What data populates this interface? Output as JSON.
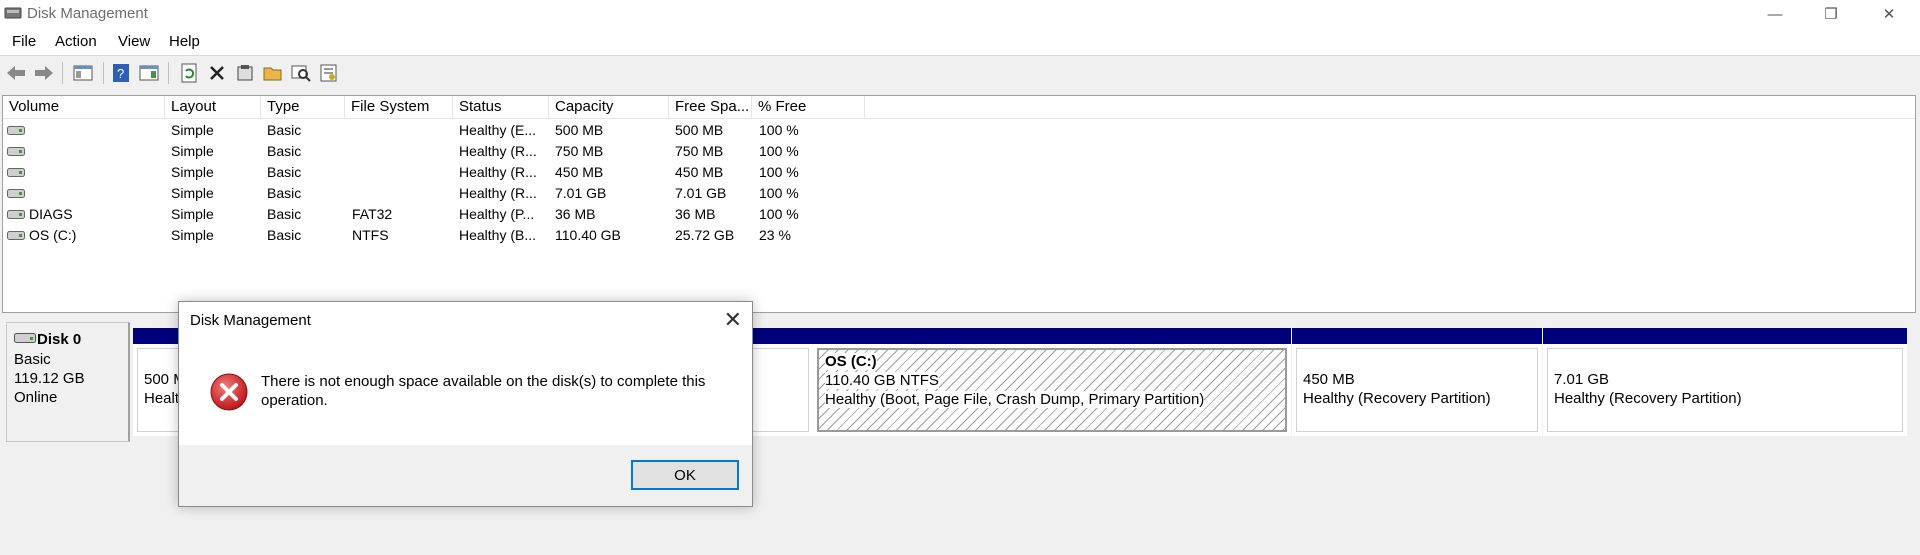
{
  "window": {
    "title": "Disk Management",
    "controls": {
      "minimize": "—",
      "maximize": "❐",
      "close": "✕"
    }
  },
  "menu": [
    "File",
    "Action",
    "View",
    "Help"
  ],
  "toolbar": {
    "icons": [
      "back-arrow-icon",
      "forward-arrow-icon",
      "console-tree-icon",
      "help-icon",
      "show-hide-pane-icon",
      "refresh-icon",
      "delete-icon",
      "properties-icon",
      "open-folder-icon",
      "search-icon",
      "settings-list-icon"
    ]
  },
  "volume_list": {
    "columns": [
      "Volume",
      "Layout",
      "Type",
      "File System",
      "Status",
      "Capacity",
      "Free Spa...",
      "% Free"
    ],
    "rows": [
      {
        "volume": "",
        "layout": "Simple",
        "type": "Basic",
        "fs": "",
        "status": "Healthy (E...",
        "capacity": "500 MB",
        "free": "500 MB",
        "pct": "100 %"
      },
      {
        "volume": "",
        "layout": "Simple",
        "type": "Basic",
        "fs": "",
        "status": "Healthy (R...",
        "capacity": "750 MB",
        "free": "750 MB",
        "pct": "100 %"
      },
      {
        "volume": "",
        "layout": "Simple",
        "type": "Basic",
        "fs": "",
        "status": "Healthy (R...",
        "capacity": "450 MB",
        "free": "450 MB",
        "pct": "100 %"
      },
      {
        "volume": "",
        "layout": "Simple",
        "type": "Basic",
        "fs": "",
        "status": "Healthy (R...",
        "capacity": "7.01 GB",
        "free": "7.01 GB",
        "pct": "100 %"
      },
      {
        "volume": "DIAGS",
        "layout": "Simple",
        "type": "Basic",
        "fs": "FAT32",
        "status": "Healthy (P...",
        "capacity": "36 MB",
        "free": "36 MB",
        "pct": "100 %"
      },
      {
        "volume": "OS (C:)",
        "layout": "Simple",
        "type": "Basic",
        "fs": "NTFS",
        "status": "Healthy (B...",
        "capacity": "110.40 GB",
        "free": "25.72 GB",
        "pct": "23 %"
      }
    ]
  },
  "disk": {
    "name": "Disk 0",
    "type": "Basic",
    "size": "119.12 GB",
    "state": "Online"
  },
  "partitions": {
    "p1": {
      "line1": "500 M",
      "line2": "Healt"
    },
    "os": {
      "name": "OS  (C:)",
      "size": "110.40 GB NTFS",
      "status": "Healthy (Boot, Page File, Crash Dump, Primary Partition)"
    },
    "p450": {
      "size": "450 MB",
      "status": "Healthy (Recovery Partition)"
    },
    "p7": {
      "size": "7.01 GB",
      "status": "Healthy (Recovery Partition)"
    }
  },
  "dialog": {
    "title": "Disk Management",
    "message": "There is not enough space available on the disk(s) to complete this operation.",
    "ok": "OK",
    "close": "✕"
  },
  "colors": {
    "partition_bar": "#00007d",
    "error_red": "#d32f2f",
    "focus_border": "#0078d7"
  }
}
